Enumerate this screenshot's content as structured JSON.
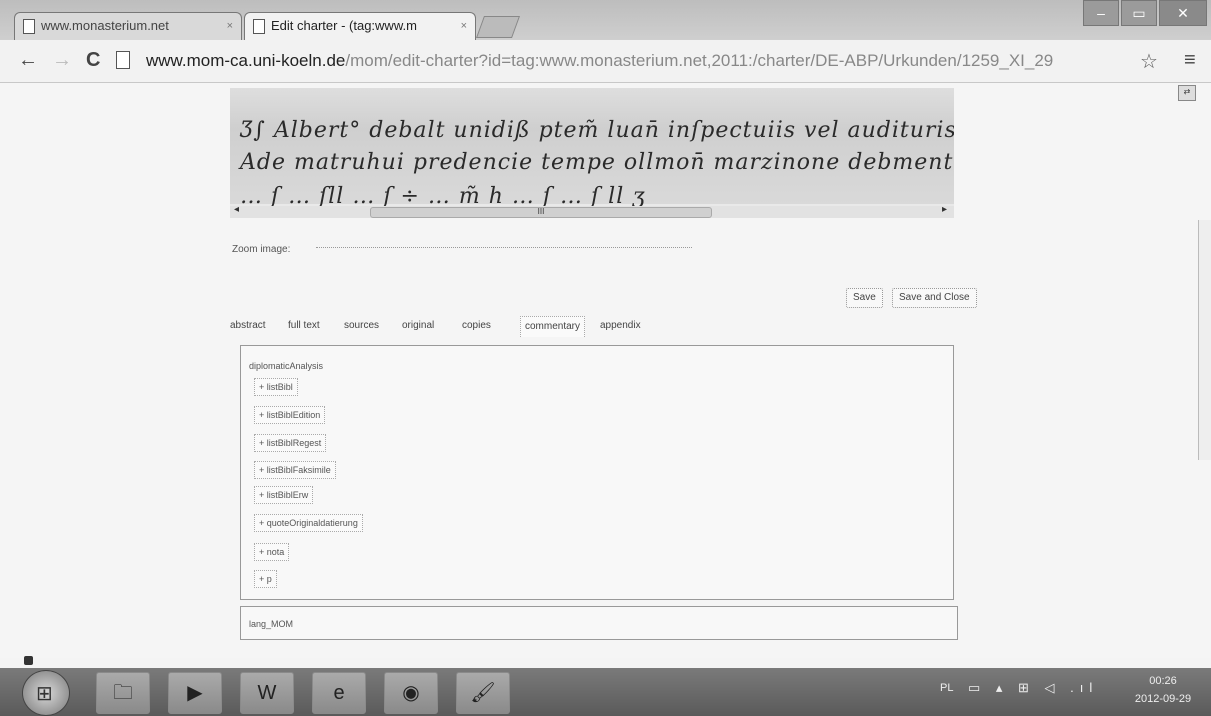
{
  "browser": {
    "tabs": [
      {
        "title": "www.monasterium.net",
        "close": "×"
      },
      {
        "title": "Edit charter - (tag:www.m",
        "close": "×"
      }
    ],
    "window_buttons": {
      "minimize": "–",
      "maximize": "▭",
      "close": "✕"
    },
    "nav": {
      "back": "←",
      "forward": "→",
      "reload": "C"
    },
    "url_host": "www.mom-ca.uni-koeln.de",
    "url_path": "/mom/edit-charter?id=tag:www.monasterium.net,2011:/charter/DE-ABP/Urkunden/1259_XI_29",
    "star": "☆",
    "menu": "≡"
  },
  "viewer": {
    "script_lines": [
      "Ʒ∫ Albert° debalt unidiß ptem̃ luan̄ inſpectuiis vel audituris ſalt̄e in",
      "Ade matruhui predencie tempe ollmon̄ marzinone debmentiſ ſubomnyre",
      "… ſ  … ſll …  ſ  ÷  …  m̃ h  … ſ …  ſ ll ʒ"
    ],
    "scroll_left": "◂",
    "scroll_right": "▸",
    "scroll_thumb": "III",
    "zoom_label": "Zoom image:"
  },
  "actions": {
    "save": "Save",
    "save_close": "Save and Close"
  },
  "content_tabs": [
    "abstract",
    "full text",
    "sources",
    "original",
    "copies",
    "commentary",
    "appendix"
  ],
  "active_tab": "commentary",
  "panel": {
    "title": "diplomaticAnalysis",
    "elements": [
      "+ listBibl",
      "+ listBiblEdition",
      "+ listBiblRegest",
      "+ listBiblFaksimile",
      "+ listBiblErw",
      "+ quoteOriginaldatierung",
      "+ nota",
      "+ p"
    ]
  },
  "lang": "lang_MOM",
  "corner_button": "⇄",
  "taskbar": {
    "start": "⊞",
    "apps": [
      {
        "name": "explorer",
        "glyph": "🗀"
      },
      {
        "name": "media-player",
        "glyph": "▶"
      },
      {
        "name": "word",
        "glyph": "W"
      },
      {
        "name": "internet-explorer",
        "glyph": "e"
      },
      {
        "name": "chrome",
        "glyph": "◉"
      },
      {
        "name": "paint",
        "glyph": "🖌"
      }
    ],
    "language": "PL",
    "tray": "▭ ▴ ⊞ ◁ .ıl",
    "time": "00:26",
    "date": "2012-09-29"
  }
}
